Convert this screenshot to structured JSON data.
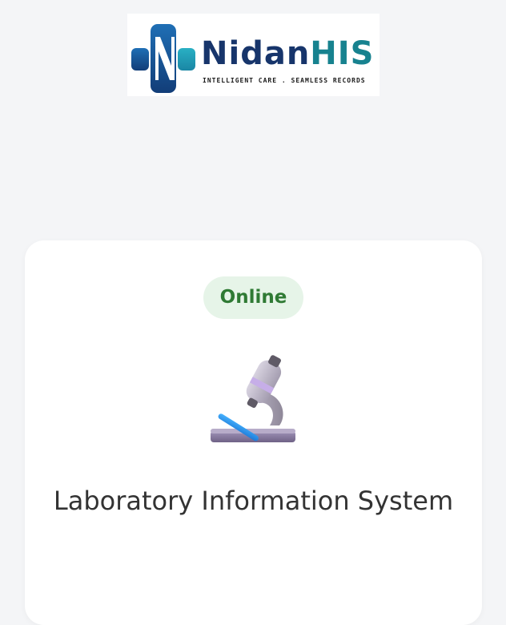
{
  "brand": {
    "word_part1": "Nidan",
    "word_part2": "HIS",
    "tagline": "INTELLIGENT CARE . SEAMLESS RECORDS",
    "colors": {
      "navy": "#17356b",
      "teal": "#17828f"
    }
  },
  "card": {
    "status": "Online",
    "status_color": "#2f7a34",
    "status_bg": "#e6f4e8",
    "icon": "microscope-icon",
    "title": "Laboratory Information System"
  }
}
